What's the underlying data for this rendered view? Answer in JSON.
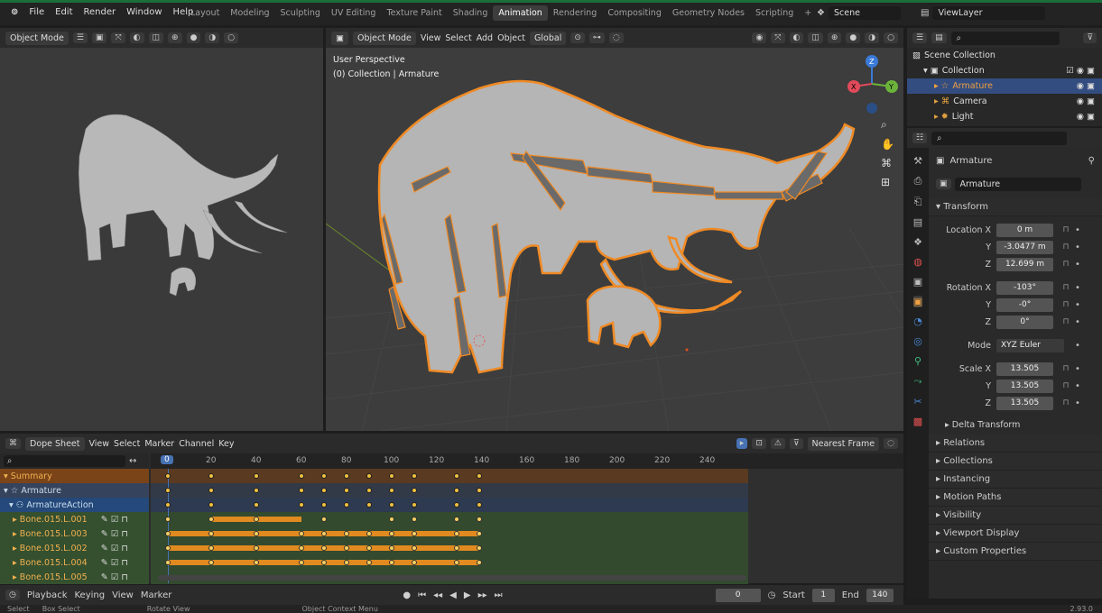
{
  "topbar": {
    "menus": [
      "File",
      "Edit",
      "Render",
      "Window",
      "Help"
    ],
    "workspaces": [
      "Layout",
      "Modeling",
      "Sculpting",
      "UV Editing",
      "Texture Paint",
      "Shading",
      "Animation",
      "Rendering",
      "Compositing",
      "Geometry Nodes",
      "Scripting"
    ],
    "active_workspace": "Animation",
    "add_tab": "+",
    "scene": "Scene",
    "view_layer": "ViewLayer"
  },
  "camera_view": {
    "mode": "Object Mode"
  },
  "viewport": {
    "mode": "Object Mode",
    "menus": [
      "View",
      "Select",
      "Add",
      "Object"
    ],
    "orientation": "Global",
    "perspective": "User Perspective",
    "collection_info": "(0) Collection | Armature",
    "gizmo_axes": [
      "Z",
      "Y",
      "X"
    ]
  },
  "outliner": {
    "root": "Scene Collection",
    "items": [
      {
        "label": "Collection",
        "icon": "collection-icon"
      },
      {
        "label": "Armature",
        "icon": "armature-icon"
      },
      {
        "label": "Camera",
        "icon": "camera-icon"
      },
      {
        "label": "Light",
        "icon": "light-icon"
      }
    ]
  },
  "properties": {
    "object_name": "Armature",
    "data_name": "Armature",
    "transform_label": "Transform",
    "location_label": "Location X",
    "location": [
      "0 m",
      "-3.0477 m",
      "12.699 m"
    ],
    "rotation_label": "Rotation X",
    "rotation": [
      "-103°",
      "-0°",
      "0°"
    ],
    "mode_label": "Mode",
    "mode_value": "XYZ Euler",
    "scale_label": "Scale X",
    "scale": [
      "13.505",
      "13.505",
      "13.505"
    ],
    "axis_y": "Y",
    "axis_z": "Z",
    "delta": "Delta Transform",
    "sections": [
      "Relations",
      "Collections",
      "Instancing",
      "Motion Paths",
      "Visibility",
      "Viewport Display",
      "Custom Properties"
    ]
  },
  "dopesheet": {
    "editor": "Dope Sheet",
    "menus": [
      "View",
      "Select",
      "Marker",
      "Channel",
      "Key"
    ],
    "snap": "Nearest Frame",
    "current_frame": "0",
    "ticks": [
      "20",
      "40",
      "60",
      "80",
      "100",
      "120",
      "140",
      "160",
      "180",
      "200",
      "220",
      "240"
    ],
    "channels": [
      {
        "label": "Summary",
        "type": "summary"
      },
      {
        "label": "Armature",
        "type": "object"
      },
      {
        "label": "ArmatureAction",
        "type": "action"
      },
      {
        "label": "Bone.015.L.001",
        "type": "bone"
      },
      {
        "label": "Bone.015.L.003",
        "type": "bone"
      },
      {
        "label": "Bone.015.L.002",
        "type": "bone"
      },
      {
        "label": "Bone.015.L.004",
        "type": "bone"
      },
      {
        "label": "Bone.015.L.005",
        "type": "bone"
      }
    ]
  },
  "timeline": {
    "menus": [
      "Playback",
      "Keying",
      "View",
      "Marker"
    ],
    "frame": "0",
    "start_label": "Start",
    "start": "1",
    "end_label": "End",
    "end": "140"
  },
  "statusbar": {
    "items": [
      "Select",
      "Box Select",
      "Rotate View",
      "Object Context Menu"
    ],
    "version": "2.93.0"
  },
  "colors": {
    "selection_orange": "#f08a24",
    "keyframe_yellow": "#f0c040",
    "accent_blue": "#4772b3"
  }
}
